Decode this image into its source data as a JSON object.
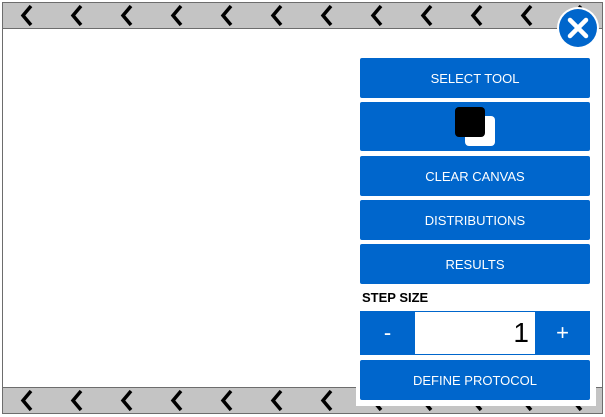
{
  "toolbar": {
    "select_tool_label": "SELECT TOOL",
    "clear_canvas_label": "CLEAR CANVAS",
    "distributions_label": "DISTRIBUTIONS",
    "results_label": "RESULTS",
    "define_protocol_label": "DEFINE PROTOCOL"
  },
  "colors": {
    "accent": "#0066cc",
    "foreground_swatch": "#000000",
    "background_swatch": "#ffffff",
    "strip": "#c4c4c4"
  },
  "step_size": {
    "label": "STEP SIZE",
    "value": "1",
    "decrement_label": "-",
    "increment_label": "+"
  },
  "icons": {
    "close": "close-icon",
    "strip_arrows": "chevron-left-icon"
  }
}
